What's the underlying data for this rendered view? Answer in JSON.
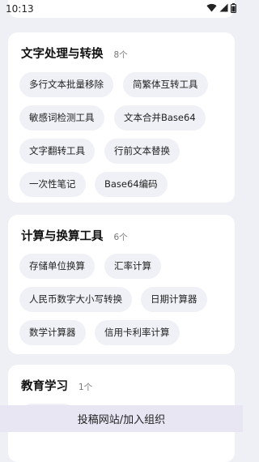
{
  "status": {
    "time": "10:13"
  },
  "sections": [
    {
      "title": "文字处理与转换",
      "count": "8个",
      "items": [
        "多行文本批量移除",
        "简繁体互转工具",
        "敏感词检测工具",
        "文本合并Base64",
        "文字翻转工具",
        "行前文本替换",
        "一次性笔记",
        "Base64编码"
      ]
    },
    {
      "title": "计算与换算工具",
      "count": "6个",
      "items": [
        "存储单位换算",
        "汇率计算",
        "人民币数字大小写转换",
        "日期计算器",
        "数学计算器",
        "信用卡利率计算"
      ]
    },
    {
      "title": "教育学习",
      "count": "1个",
      "items": []
    }
  ],
  "bottom_bar": {
    "label": "投稿网站/加入组织"
  }
}
